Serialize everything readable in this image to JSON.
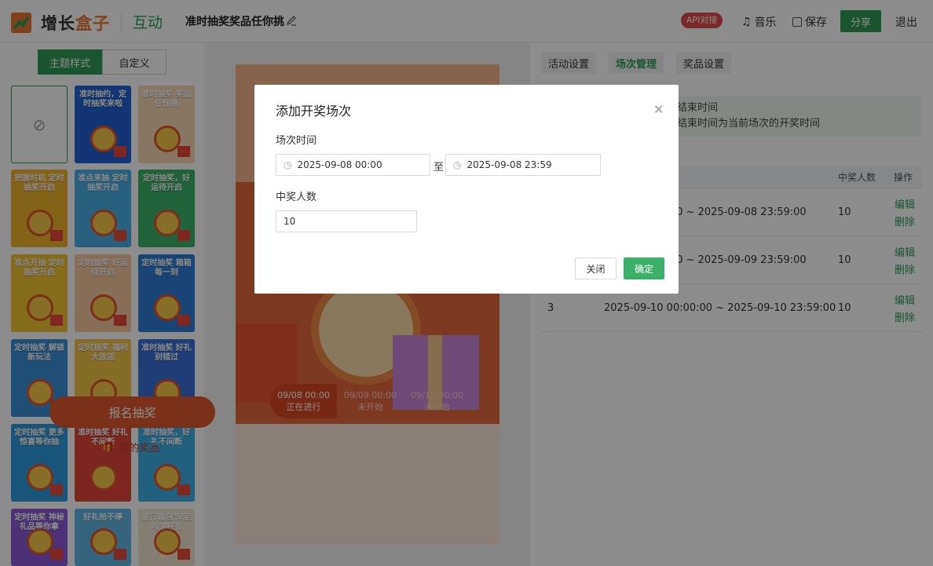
{
  "header": {
    "logo_text_a": "增长",
    "logo_text_b": "盒子",
    "logo_sub": "互动",
    "activity_title": "准时抽奖奖品任你挑",
    "api_badge": "API对接",
    "music": "音乐",
    "save": "保存",
    "share": "分享",
    "exit": "退出"
  },
  "left_panel": {
    "tab_theme": "主题样式",
    "tab_custom": "自定义",
    "themes": [
      "准时抽约，定时抽奖来啦",
      "准时抽奖 奖品任你挑",
      "把握时机 定时抽奖开启",
      "准点来抽 定时抽奖开启",
      "定时抽奖，好运待开启",
      "准点开抽 定时抽奖开启",
      "定时抽奖 好运待开启",
      "定时抽奖 箱箱每一刻",
      "定时抽奖 解锁新玩法",
      "定时抽奖 福利大放送",
      "准时抽奖 好礼别错过",
      "定时抽奖 更多惊喜等你抽",
      "准时抽奖 好礼不间断",
      "准时抽奖，好礼不间断",
      "定时抽奖 神秘礼品等你拿",
      "好礼抢不停",
      "旅行箱包节 定时领好礼"
    ]
  },
  "preview": {
    "schedules": [
      {
        "time": "09/08 00:00",
        "status": "正在进行"
      },
      {
        "time": "09/09 00:00",
        "status": "未开始"
      },
      {
        "time": "09/10 00:00",
        "status": "未开始"
      }
    ],
    "signup_button": "报名抽奖",
    "my_prize": "我的奖品"
  },
  "right_panel": {
    "tabs": [
      "活动设置",
      "场次管理",
      "奖品设置"
    ],
    "notice_line1": "动结束时间",
    "notice_line2": "的结束时间为当前场次的开奖时间",
    "table_headers": {
      "winners": "中奖人数",
      "ops": "操作"
    },
    "rows": [
      {
        "index": "",
        "range": "00:00 ~ 2025-09-08 23:59:00",
        "winners": "10",
        "edit": "编辑",
        "delete": "删除"
      },
      {
        "index": "",
        "range": "00:00 ~ 2025-09-09 23:59:00",
        "winners": "10",
        "edit": "编辑",
        "delete": "删除"
      },
      {
        "index": "3",
        "range": "2025-09-10 00:00:00 ~ 2025-09-10 23:59:00",
        "winners": "10",
        "edit": "编辑",
        "delete": "删除"
      }
    ]
  },
  "modal": {
    "title": "添加开奖场次",
    "label_time": "场次时间",
    "start_time": "2025-09-08 00:00",
    "separator": "至",
    "end_time": "2025-09-08 23:59",
    "label_winners": "中奖人数",
    "winners_value": "10",
    "cancel": "关闭",
    "confirm": "确定"
  },
  "colors": {
    "brand_green": "#2e9b57",
    "accent_orange": "#e8772e",
    "api_red": "#e04a4a"
  }
}
